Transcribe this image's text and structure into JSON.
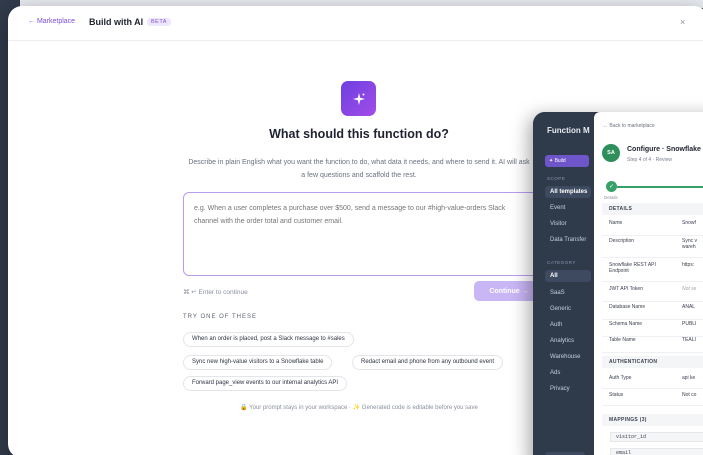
{
  "window": {
    "back_link": "← Marketplace",
    "title": "Build with AI",
    "badge": "BETA",
    "close": "×"
  },
  "hero": {
    "icon": "sparkle-icon",
    "heading": "What should this function do?",
    "description": "Describe in plain English what you want the function to do, what data it needs, and where to send it. AI will ask a few questions and scaffold the rest."
  },
  "prompt": {
    "placeholder": "e.g. When a user completes a purchase over $500, send a message to our #high-value-orders Slack channel with the order total and customer email.",
    "value": "",
    "enter_hint": "⌘ ↵ Enter to continue",
    "continue_label": "Continue →"
  },
  "suggestions": {
    "label": "TRY ONE OF THESE",
    "items": [
      "When an order is placed, post a Slack message to #sales",
      "Sync new high-value visitors to a Snowflake table",
      "Redact email and phone from any outbound event",
      "Forward page_view events to our internal analytics API"
    ]
  },
  "footer": "🔒 Your prompt stays in your workspace · ✨ Generated code is editable before you save",
  "overlay": {
    "sidebar": {
      "title": "Function M",
      "build_button": "✦ Build",
      "scope_label": "SCOPE",
      "scope_items": [
        "All templates",
        "Event",
        "Visitor",
        "Data Transfer"
      ],
      "category_label": "CATEGORY",
      "category_items": [
        "All",
        "SaaS",
        "Generic",
        "Auth",
        "Analytics",
        "Warehouse",
        "Ads",
        "Privacy"
      ]
    },
    "panel": {
      "back": "← Back to marketplace",
      "avatar": "SA",
      "title": "Configure · Snowflake",
      "step": "Step 4 of 4 · Review",
      "progress_label": "Details",
      "details_title": "DETAILS",
      "details": [
        {
          "key": "Name",
          "value": "Snowf"
        },
        {
          "key": "Description",
          "value": "Sync v\nwareh"
        },
        {
          "key": "Snowflake REST API Endpoint",
          "value": "https:"
        },
        {
          "key": "JWT API Token",
          "value": "Not se"
        },
        {
          "key": "Database Name",
          "value": "ANAL"
        },
        {
          "key": "Schema Name",
          "value": "PUBLI"
        },
        {
          "key": "Table Name",
          "value": "TEALI"
        }
      ],
      "auth_title": "AUTHENTICATION",
      "auth": [
        {
          "key": "Auth Type",
          "value": "api ke"
        },
        {
          "key": "Status",
          "value": "Not co"
        }
      ],
      "mappings_title": "MAPPINGS (3)",
      "mappings": [
        "visitor_id",
        "email"
      ]
    }
  }
}
